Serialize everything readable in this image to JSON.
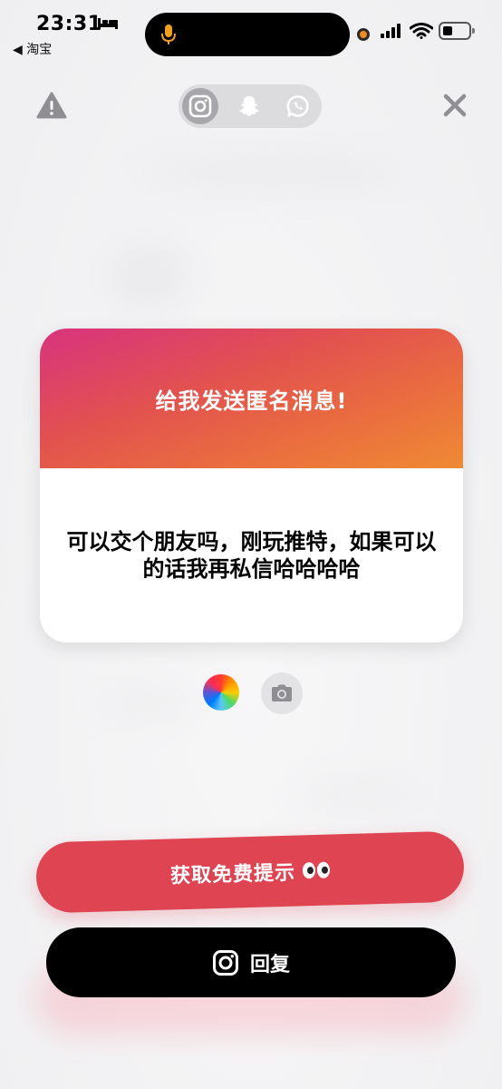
{
  "status_bar": {
    "time": "23:31",
    "back_app": "◀ 淘宝"
  },
  "nav": {
    "platforms": [
      "instagram",
      "snapchat",
      "whatsapp"
    ],
    "active_platform": "instagram"
  },
  "card": {
    "title": "给我发送匿名消息!",
    "message": "可以交个朋友吗，刚玩推特，如果可以的话我再私信哈哈哈哈",
    "gradient_colors": [
      "#d8337e",
      "#e2524f",
      "#ef8a33"
    ]
  },
  "actions": {
    "hint_label": "获取免费提示",
    "hint_color": "#df4452",
    "reply_label": "回复",
    "reply_color": "#000000"
  }
}
